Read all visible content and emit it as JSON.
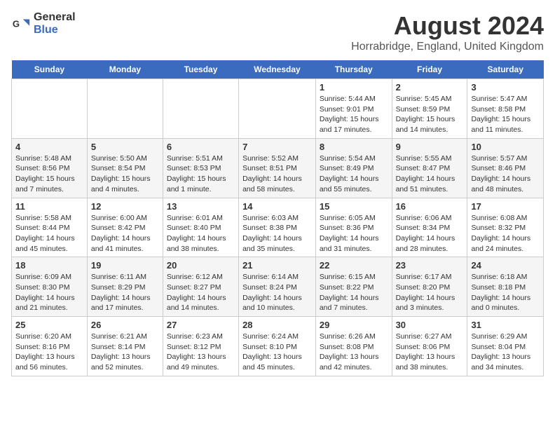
{
  "header": {
    "logo_general": "General",
    "logo_blue": "Blue",
    "main_title": "August 2024",
    "subtitle": "Horrabridge, England, United Kingdom"
  },
  "days": [
    "Sunday",
    "Monday",
    "Tuesday",
    "Wednesday",
    "Thursday",
    "Friday",
    "Saturday"
  ],
  "weeks": [
    [
      {
        "date": "",
        "sunrise": "",
        "sunset": "",
        "daylight": "",
        "empty": true
      },
      {
        "date": "",
        "sunrise": "",
        "sunset": "",
        "daylight": "",
        "empty": true
      },
      {
        "date": "",
        "sunrise": "",
        "sunset": "",
        "daylight": "",
        "empty": true
      },
      {
        "date": "",
        "sunrise": "",
        "sunset": "",
        "daylight": "",
        "empty": true
      },
      {
        "date": "1",
        "sunrise": "Sunrise: 5:44 AM",
        "sunset": "Sunset: 9:01 PM",
        "daylight": "Daylight: 15 hours and 17 minutes."
      },
      {
        "date": "2",
        "sunrise": "Sunrise: 5:45 AM",
        "sunset": "Sunset: 8:59 PM",
        "daylight": "Daylight: 15 hours and 14 minutes."
      },
      {
        "date": "3",
        "sunrise": "Sunrise: 5:47 AM",
        "sunset": "Sunset: 8:58 PM",
        "daylight": "Daylight: 15 hours and 11 minutes."
      }
    ],
    [
      {
        "date": "4",
        "sunrise": "Sunrise: 5:48 AM",
        "sunset": "Sunset: 8:56 PM",
        "daylight": "Daylight: 15 hours and 7 minutes."
      },
      {
        "date": "5",
        "sunrise": "Sunrise: 5:50 AM",
        "sunset": "Sunset: 8:54 PM",
        "daylight": "Daylight: 15 hours and 4 minutes."
      },
      {
        "date": "6",
        "sunrise": "Sunrise: 5:51 AM",
        "sunset": "Sunset: 8:53 PM",
        "daylight": "Daylight: 15 hours and 1 minute."
      },
      {
        "date": "7",
        "sunrise": "Sunrise: 5:52 AM",
        "sunset": "Sunset: 8:51 PM",
        "daylight": "Daylight: 14 hours and 58 minutes."
      },
      {
        "date": "8",
        "sunrise": "Sunrise: 5:54 AM",
        "sunset": "Sunset: 8:49 PM",
        "daylight": "Daylight: 14 hours and 55 minutes."
      },
      {
        "date": "9",
        "sunrise": "Sunrise: 5:55 AM",
        "sunset": "Sunset: 8:47 PM",
        "daylight": "Daylight: 14 hours and 51 minutes."
      },
      {
        "date": "10",
        "sunrise": "Sunrise: 5:57 AM",
        "sunset": "Sunset: 8:46 PM",
        "daylight": "Daylight: 14 hours and 48 minutes."
      }
    ],
    [
      {
        "date": "11",
        "sunrise": "Sunrise: 5:58 AM",
        "sunset": "Sunset: 8:44 PM",
        "daylight": "Daylight: 14 hours and 45 minutes."
      },
      {
        "date": "12",
        "sunrise": "Sunrise: 6:00 AM",
        "sunset": "Sunset: 8:42 PM",
        "daylight": "Daylight: 14 hours and 41 minutes."
      },
      {
        "date": "13",
        "sunrise": "Sunrise: 6:01 AM",
        "sunset": "Sunset: 8:40 PM",
        "daylight": "Daylight: 14 hours and 38 minutes."
      },
      {
        "date": "14",
        "sunrise": "Sunrise: 6:03 AM",
        "sunset": "Sunset: 8:38 PM",
        "daylight": "Daylight: 14 hours and 35 minutes."
      },
      {
        "date": "15",
        "sunrise": "Sunrise: 6:05 AM",
        "sunset": "Sunset: 8:36 PM",
        "daylight": "Daylight: 14 hours and 31 minutes."
      },
      {
        "date": "16",
        "sunrise": "Sunrise: 6:06 AM",
        "sunset": "Sunset: 8:34 PM",
        "daylight": "Daylight: 14 hours and 28 minutes."
      },
      {
        "date": "17",
        "sunrise": "Sunrise: 6:08 AM",
        "sunset": "Sunset: 8:32 PM",
        "daylight": "Daylight: 14 hours and 24 minutes."
      }
    ],
    [
      {
        "date": "18",
        "sunrise": "Sunrise: 6:09 AM",
        "sunset": "Sunset: 8:30 PM",
        "daylight": "Daylight: 14 hours and 21 minutes."
      },
      {
        "date": "19",
        "sunrise": "Sunrise: 6:11 AM",
        "sunset": "Sunset: 8:29 PM",
        "daylight": "Daylight: 14 hours and 17 minutes."
      },
      {
        "date": "20",
        "sunrise": "Sunrise: 6:12 AM",
        "sunset": "Sunset: 8:27 PM",
        "daylight": "Daylight: 14 hours and 14 minutes."
      },
      {
        "date": "21",
        "sunrise": "Sunrise: 6:14 AM",
        "sunset": "Sunset: 8:24 PM",
        "daylight": "Daylight: 14 hours and 10 minutes."
      },
      {
        "date": "22",
        "sunrise": "Sunrise: 6:15 AM",
        "sunset": "Sunset: 8:22 PM",
        "daylight": "Daylight: 14 hours and 7 minutes."
      },
      {
        "date": "23",
        "sunrise": "Sunrise: 6:17 AM",
        "sunset": "Sunset: 8:20 PM",
        "daylight": "Daylight: 14 hours and 3 minutes."
      },
      {
        "date": "24",
        "sunrise": "Sunrise: 6:18 AM",
        "sunset": "Sunset: 8:18 PM",
        "daylight": "Daylight: 14 hours and 0 minutes."
      }
    ],
    [
      {
        "date": "25",
        "sunrise": "Sunrise: 6:20 AM",
        "sunset": "Sunset: 8:16 PM",
        "daylight": "Daylight: 13 hours and 56 minutes."
      },
      {
        "date": "26",
        "sunrise": "Sunrise: 6:21 AM",
        "sunset": "Sunset: 8:14 PM",
        "daylight": "Daylight: 13 hours and 52 minutes."
      },
      {
        "date": "27",
        "sunrise": "Sunrise: 6:23 AM",
        "sunset": "Sunset: 8:12 PM",
        "daylight": "Daylight: 13 hours and 49 minutes."
      },
      {
        "date": "28",
        "sunrise": "Sunrise: 6:24 AM",
        "sunset": "Sunset: 8:10 PM",
        "daylight": "Daylight: 13 hours and 45 minutes."
      },
      {
        "date": "29",
        "sunrise": "Sunrise: 6:26 AM",
        "sunset": "Sunset: 8:08 PM",
        "daylight": "Daylight: 13 hours and 42 minutes."
      },
      {
        "date": "30",
        "sunrise": "Sunrise: 6:27 AM",
        "sunset": "Sunset: 8:06 PM",
        "daylight": "Daylight: 13 hours and 38 minutes."
      },
      {
        "date": "31",
        "sunrise": "Sunrise: 6:29 AM",
        "sunset": "Sunset: 8:04 PM",
        "daylight": "Daylight: 13 hours and 34 minutes."
      }
    ]
  ]
}
